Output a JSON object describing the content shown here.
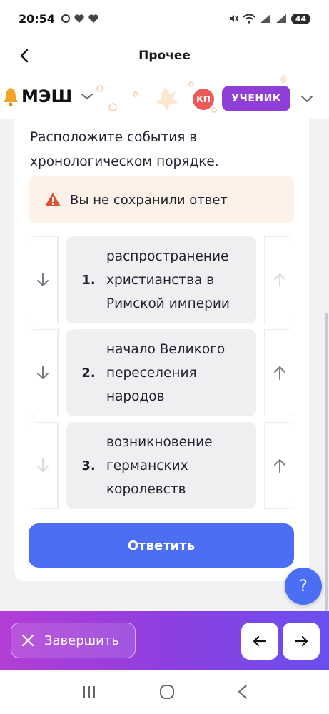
{
  "status_bar": {
    "time": "20:54",
    "battery": "44"
  },
  "app_bar": {
    "title": "Прочее"
  },
  "header": {
    "logo": "МЭШ",
    "avatar_initials": "КП",
    "role": "УЧЕНИК"
  },
  "task": {
    "question": "Расположите события в хронологическом порядке.",
    "warning": "Вы не сохранили ответ",
    "items": [
      {
        "number": "1.",
        "text": "распространение христианства в Римской империи",
        "down_enabled": true,
        "up_enabled": false
      },
      {
        "number": "2.",
        "text": "начало Великого переселения народов",
        "down_enabled": true,
        "up_enabled": true
      },
      {
        "number": "3.",
        "text": "возникновение германских королевств",
        "down_enabled": false,
        "up_enabled": true
      }
    ],
    "submit_label": "Ответить"
  },
  "help": {
    "label": "?"
  },
  "bottom_bar": {
    "finish_label": "Завершить"
  },
  "colors": {
    "accent": "#4b6ef5",
    "role_badge": "#8f3ed8",
    "avatar": "#ec5a5a",
    "warning_bg": "#fdf1e8",
    "warning_icon": "#e2512e"
  }
}
